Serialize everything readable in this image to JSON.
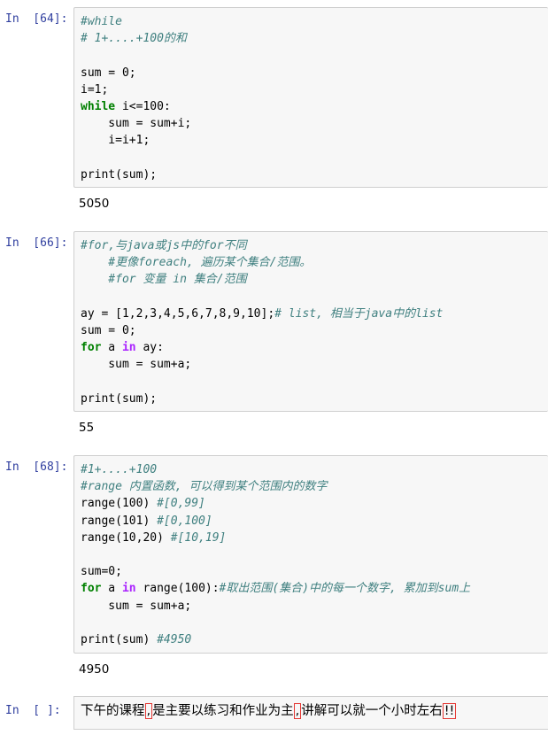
{
  "cells": [
    {
      "prompt": "In  [64]:",
      "lines": [
        [
          {
            "t": "#while",
            "c": "cm"
          }
        ],
        [
          {
            "t": "# 1+....+100的和",
            "c": "cm"
          }
        ],
        [],
        [
          {
            "t": "sum = 0;",
            "c": "nm"
          }
        ],
        [
          {
            "t": "i=1;",
            "c": "nm"
          }
        ],
        [
          {
            "t": "while",
            "c": "kw"
          },
          {
            "t": " i<=100:",
            "c": "nm"
          }
        ],
        [
          {
            "t": "    sum = sum+i;",
            "c": "nm"
          }
        ],
        [
          {
            "t": "    i=i+1;",
            "c": "nm"
          }
        ],
        [],
        [
          {
            "t": "print(sum);",
            "c": "nm"
          }
        ]
      ],
      "output": "5050"
    },
    {
      "prompt": "In  [66]:",
      "lines": [
        [
          {
            "t": "#for,与java或js中的for不同",
            "c": "cm"
          }
        ],
        [
          {
            "t": "    #更像foreach, 遍历某个集合/范围。",
            "c": "cm"
          }
        ],
        [
          {
            "t": "    #for 变量 in 集合/范围",
            "c": "cm"
          }
        ],
        [],
        [
          {
            "t": "ay = [1,2,3,4,5,6,7,8,9,10];",
            "c": "nm"
          },
          {
            "t": "# list, 相当于java中的list",
            "c": "cm"
          }
        ],
        [
          {
            "t": "sum = 0;",
            "c": "nm"
          }
        ],
        [
          {
            "t": "for",
            "c": "kw"
          },
          {
            "t": " a ",
            "c": "nm"
          },
          {
            "t": "in",
            "c": "op"
          },
          {
            "t": " ay:",
            "c": "nm"
          }
        ],
        [
          {
            "t": "    sum = sum+a;",
            "c": "nm"
          }
        ],
        [],
        [
          {
            "t": "print(sum);",
            "c": "nm"
          }
        ]
      ],
      "output": "55"
    },
    {
      "prompt": "In  [68]:",
      "lines": [
        [
          {
            "t": "#1+....+100",
            "c": "cm"
          }
        ],
        [
          {
            "t": "#range 内置函数, 可以得到某个范围内的数字",
            "c": "cm"
          }
        ],
        [
          {
            "t": "range(100) ",
            "c": "nm"
          },
          {
            "t": "#[0,99]",
            "c": "cm"
          }
        ],
        [
          {
            "t": "range(101) ",
            "c": "nm"
          },
          {
            "t": "#[0,100]",
            "c": "cm"
          }
        ],
        [
          {
            "t": "range(10,20) ",
            "c": "nm"
          },
          {
            "t": "#[10,19]",
            "c": "cm"
          }
        ],
        [],
        [
          {
            "t": "sum=0;",
            "c": "nm"
          }
        ],
        [
          {
            "t": "for",
            "c": "kw"
          },
          {
            "t": " a ",
            "c": "nm"
          },
          {
            "t": "in",
            "c": "op"
          },
          {
            "t": " range(100):",
            "c": "nm"
          },
          {
            "t": "#取出范围(集合)中的每一个数字, 累加到sum上",
            "c": "cm"
          }
        ],
        [
          {
            "t": "    sum = sum+a;",
            "c": "nm"
          }
        ],
        [],
        [
          {
            "t": "print(sum) ",
            "c": "nm"
          },
          {
            "t": "#4950",
            "c": "cm"
          }
        ]
      ],
      "output": "4950"
    }
  ],
  "md_cell": {
    "prompt": "In  [ ]:",
    "parts": [
      {
        "t": "下午的课程",
        "mark": false
      },
      {
        "t": ",",
        "mark": true
      },
      {
        "t": "是主要以练习和作业为主",
        "mark": false
      },
      {
        "t": ",",
        "mark": true
      },
      {
        "t": "讲解可以就一个小时左右",
        "mark": false
      },
      {
        "t": "!!",
        "mark": true
      }
    ]
  },
  "colors": {
    "prompt": "#303f9f",
    "comment": "#408080",
    "keyword": "#008000",
    "operator": "#aa22ff",
    "cell_bg": "#f7f7f7",
    "mark_border": "#e53935"
  }
}
